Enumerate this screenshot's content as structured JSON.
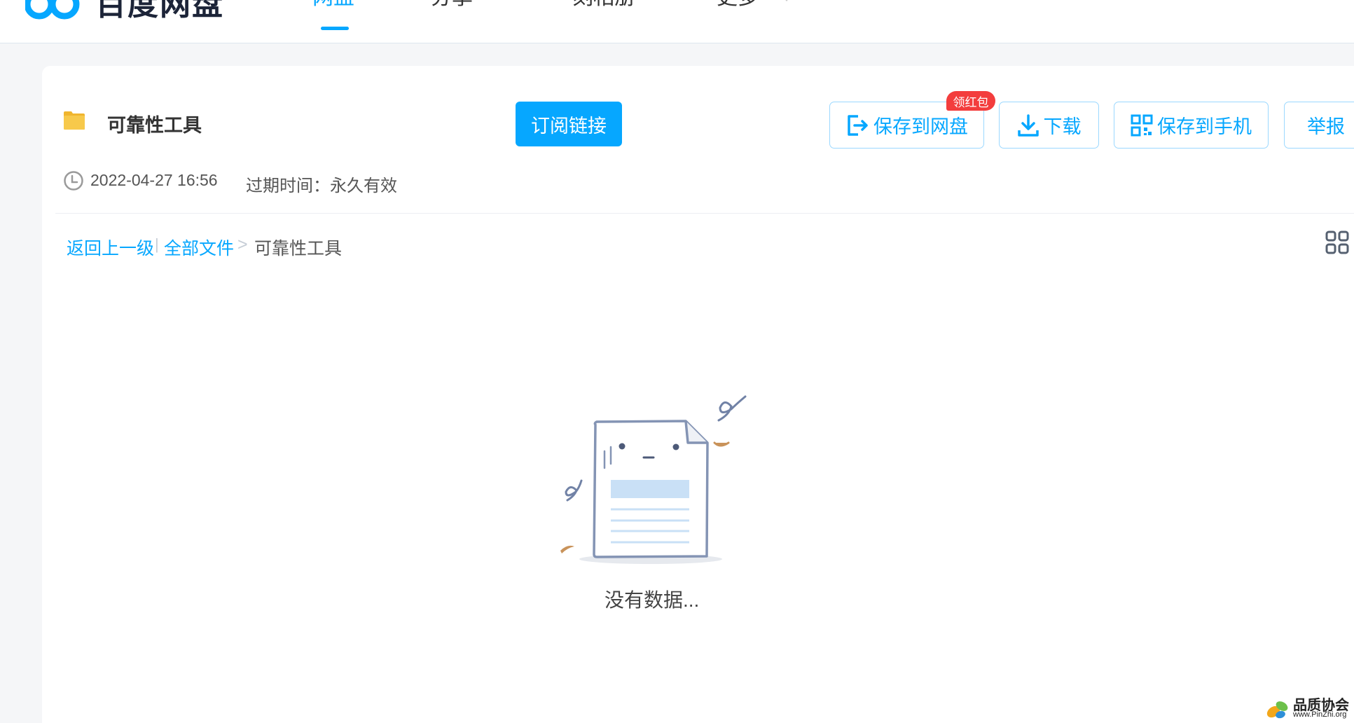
{
  "header": {
    "logo_text": "百度网盘",
    "nav": [
      "网盘",
      "分享",
      "一刻相册",
      "更多"
    ]
  },
  "share": {
    "title": "可靠性工具",
    "subscribe_label": "订阅链接",
    "save_label": "保存到网盘",
    "save_badge": "领红包",
    "download_label": "下载",
    "save_phone_label": "保存到手机",
    "report_label": "举报",
    "date": "2022-04-27 16:56",
    "expire": "过期时间：永久有效"
  },
  "breadcrumb": {
    "back": "返回上一级",
    "separator": "|",
    "all_files": "全部文件",
    "arrow": ">",
    "current": "可靠性工具"
  },
  "empty_state": {
    "text": "没有数据..."
  },
  "watermark": {
    "title": "品质协会",
    "url": "www.PinZhi.org"
  },
  "colors": {
    "accent": "#06a7ff",
    "badge": "#f33d3d",
    "folder": "#f5c043"
  }
}
